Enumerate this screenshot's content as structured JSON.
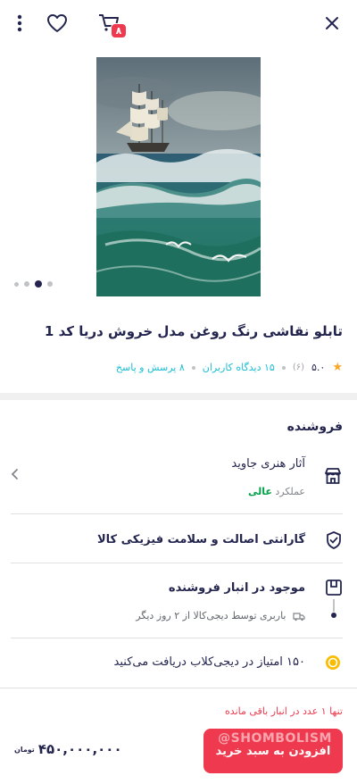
{
  "header": {
    "cart_count": "۸",
    "icons": [
      "more-icon",
      "heart-icon",
      "cart-icon",
      "close-icon"
    ]
  },
  "gallery": {
    "active_index": 2,
    "count": 4
  },
  "product": {
    "title": "تابلو نقاشی رنگ روغن مدل خروش دریا کد 1",
    "rating": "۵.۰",
    "rating_count": "(۶)",
    "reviews": "۱۵ دیدگاه کاربران",
    "questions": "۸ پرسش و پاسخ"
  },
  "seller": {
    "heading": "فروشنده",
    "name": "آثار هنری جاوید",
    "performance_label": "عملکرد",
    "performance_value": "عالی"
  },
  "warranty": {
    "text": "گارانتی اصالت و سلامت فیزیکی کالا"
  },
  "stock": {
    "status": "موجود در انبار فروشنده",
    "shipping": "باربری توسط دیجی‌کالا از ۲ روز دیگر"
  },
  "points": {
    "text": "۱۵۰ امتیاز در دیجی‌کلاب دریافت می‌کنید"
  },
  "buy": {
    "remaining": "تنها ۱ عدد در انبار باقی مانده",
    "add_to_cart": "افزودن به سبد خرید",
    "price": "۴۵۰,۰۰۰,۰۰۰",
    "currency": "تومان",
    "watermark": "@SHOMBOLISM"
  },
  "colors": {
    "accent": "#ef394e",
    "link": "#19bfd3",
    "success": "#00a049",
    "text": "#23254e"
  }
}
